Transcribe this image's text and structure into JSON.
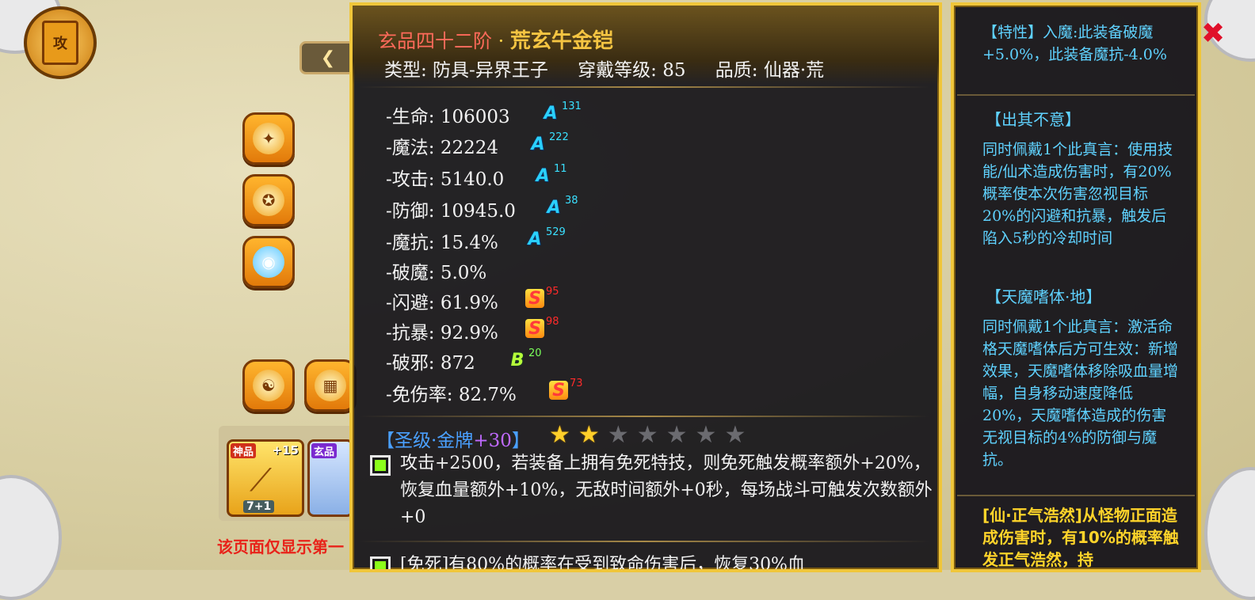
{
  "item": {
    "grade": "玄品四十二阶",
    "separator": "·",
    "name": "荒玄牛金铠",
    "type_label": "类型: 防具-异界王子",
    "level_label": "穿戴等级: 85",
    "quality_label": "品质: 仙器·荒"
  },
  "stats": [
    {
      "label": "-生命: 106003",
      "grade": "A",
      "value": "131"
    },
    {
      "label": "-魔法: 22224",
      "grade": "A",
      "value": "222"
    },
    {
      "label": "-攻击: 5140.0",
      "grade": "A",
      "value": "11"
    },
    {
      "label": "-防御: 10945.0",
      "grade": "A",
      "value": "38"
    },
    {
      "label": "-魔抗: 15.4%",
      "grade": "A",
      "value": "529"
    },
    {
      "label": "-破魔: 5.0%",
      "grade": "",
      "value": ""
    },
    {
      "label": "-闪避: 61.9%",
      "grade": "S",
      "value": "95"
    },
    {
      "label": "-抗暴: 92.9%",
      "grade": "S",
      "value": "98"
    },
    {
      "label": "-破邪: 872",
      "grade": "B",
      "value": "20"
    },
    {
      "label": "-免伤率: 82.7%",
      "grade": "S",
      "value": "73"
    }
  ],
  "holy": {
    "open": "【圣级·金牌",
    "level": "+30",
    "close": "】",
    "stars_on": 2,
    "stars_total": 7
  },
  "effects": [
    "攻击+2500，若装备上拥有免死特技，则免死触发概率额外+20%，恢复血量额外+10%，无敌时间额外+0秒，每场战斗可触发次数额外+0",
    "[免死]有80%的概率在受到致命伤害后，恢复30%血"
  ],
  "side": {
    "trait": "【特性】入魔:此装备破魔+5.0%，此装备魔抗-4.0%",
    "sec1_title": "【出其不意】",
    "sec1_text": "同时佩戴1个此真言：使用技能/仙术造成伤害时，有20%概率使本次伤害忽视目标20%的闪避和抗暴，触发后陷入5秒的冷却时间",
    "sec2_title": "【天魔嗜体·地】",
    "sec2_text": "同时佩戴1个此真言：激活命格天魔嗜体后方可生效：新增效果，天魔嗜体移除吸血量增幅，自身移动速度降低20%，天魔嗜体造成的伤害无视目标的4%的防御与魔抗。",
    "yellow_text": "[仙·正气浩然]从怪物正面造成伤害时，有10%的概率触发正气浩然，持"
  },
  "background": {
    "top_icon": "攻",
    "slot1_tag": "神品",
    "slot1_plus": "+15",
    "slot1_bottom": "7+1",
    "slot2_tag": "玄品",
    "notice": "该页面仅显示第一"
  },
  "colors": {
    "border": "#f0c63a",
    "title_red": "#ff6a5a",
    "name_gold": "#f5c542",
    "side_cyan": "#5fd2ff",
    "check_green": "#8cff1a"
  }
}
